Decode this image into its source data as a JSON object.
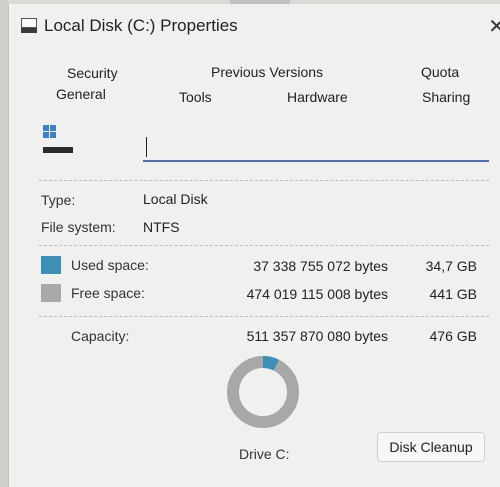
{
  "window": {
    "title": "Local Disk (C:) Properties",
    "close_glyph": "✕"
  },
  "tabs_row1": [
    "Security",
    "Previous Versions",
    "Quota"
  ],
  "tabs_row2": [
    "General",
    "Tools",
    "Hardware",
    "Sharing"
  ],
  "active_tab": "General",
  "name_field": {
    "value": ""
  },
  "general": {
    "type_label": "Type:",
    "type_value": "Local Disk",
    "fs_label": "File system:",
    "fs_value": "NTFS"
  },
  "space": {
    "used": {
      "label": "Used space:",
      "bytes": "37 338 755 072 bytes",
      "size": "34,7 GB",
      "color": "#3c8fb5"
    },
    "free": {
      "label": "Free space:",
      "bytes": "474 019 115 008 bytes",
      "size": "441 GB",
      "color": "#a8a8a8"
    },
    "capacity": {
      "label": "Capacity:",
      "bytes": "511 357 870 080 bytes",
      "size": "476 GB"
    },
    "used_fraction": 0.073
  },
  "drive": {
    "label": "Drive C:"
  },
  "buttons": {
    "disk_cleanup": "Disk Cleanup"
  }
}
